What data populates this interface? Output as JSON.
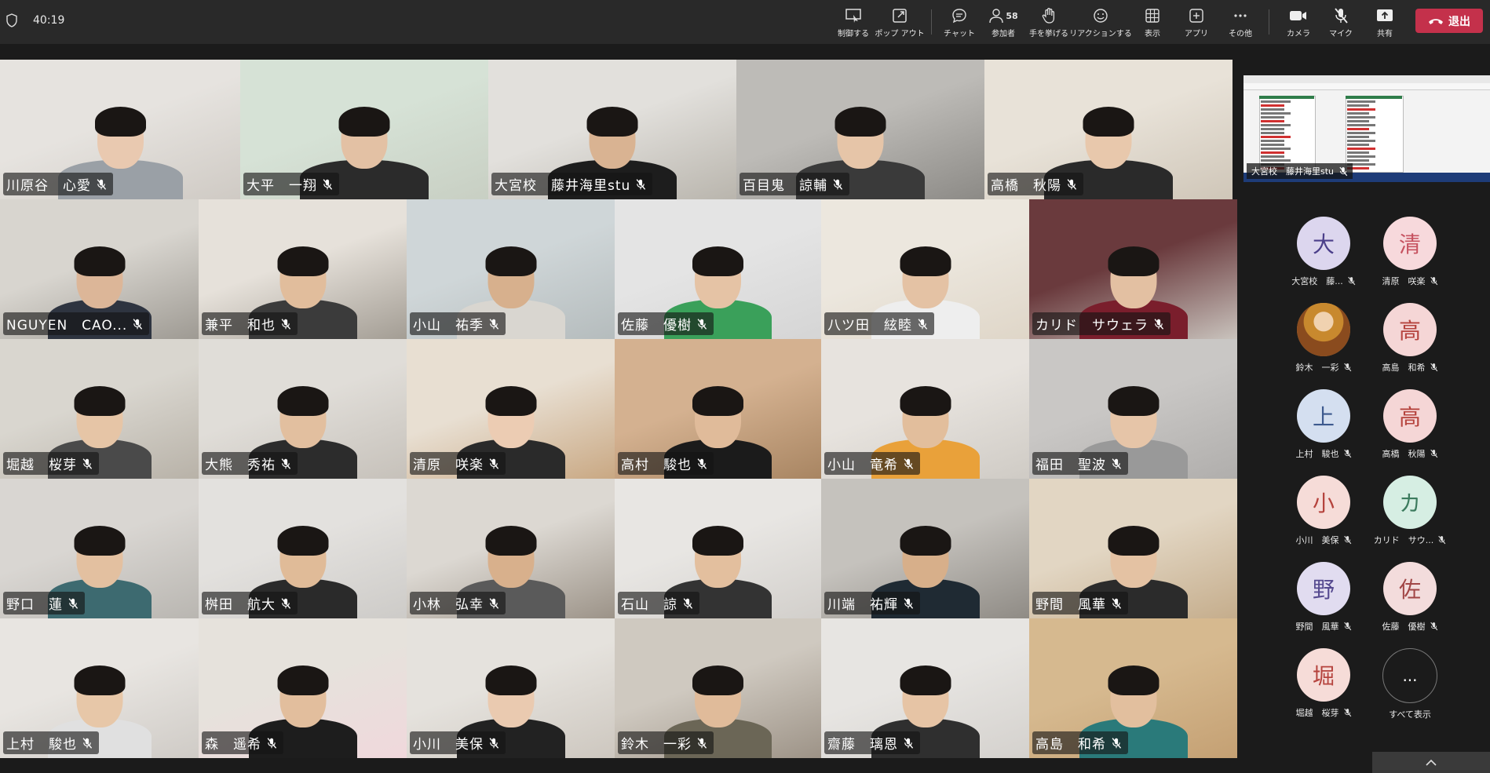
{
  "timer": "40:19",
  "toolbar": [
    {
      "name": "control-button",
      "icon": "control-icon",
      "label": "制御する"
    },
    {
      "name": "popout-button",
      "icon": "popout-icon",
      "label": "ポップ アウト"
    },
    {
      "name": "chat-button",
      "icon": "chat-icon",
      "label": "チャット"
    },
    {
      "name": "participants-button",
      "icon": "people-icon",
      "label": "参加者",
      "count": "58"
    },
    {
      "name": "raise-hand-button",
      "icon": "hand-icon",
      "label": "手を挙げる"
    },
    {
      "name": "reaction-button",
      "icon": "smile-icon",
      "label": "リアクションする"
    },
    {
      "name": "view-button",
      "icon": "grid-icon",
      "label": "表示"
    },
    {
      "name": "apps-button",
      "icon": "plus-box-icon",
      "label": "アプリ"
    },
    {
      "name": "more-button",
      "icon": "ellipsis-icon",
      "label": "その他"
    },
    {
      "name": "camera-button",
      "icon": "camera-icon",
      "label": "カメラ"
    },
    {
      "name": "mic-button",
      "icon": "mic-off-icon",
      "label": "マイク"
    },
    {
      "name": "share-button",
      "icon": "share-icon",
      "label": "共有"
    }
  ],
  "leave_label": "退出",
  "video_tiles": [
    {
      "name": "川原谷　心愛"
    },
    {
      "name": "大平　一翔"
    },
    {
      "name": "大宮校　藤井海里stu"
    },
    {
      "name": "百目鬼　諒輔"
    },
    {
      "name": "高橋　秋陽"
    },
    {
      "name": "NGUYEN　CAO..."
    },
    {
      "name": "兼平　和也"
    },
    {
      "name": "小山　祐季"
    },
    {
      "name": "佐藤　優樹"
    },
    {
      "name": "八ツ田　絃睦"
    },
    {
      "name": "カリド　サウェラ"
    },
    {
      "name": "堀越　桜芽"
    },
    {
      "name": "大熊　秀祐"
    },
    {
      "name": "清原　咲楽"
    },
    {
      "name": "高村　駿也"
    },
    {
      "name": "小山　竜希"
    },
    {
      "name": "福田　聖波"
    },
    {
      "name": "野口　蓮"
    },
    {
      "name": "桝田　航大"
    },
    {
      "name": "小林　弘幸"
    },
    {
      "name": "石山　諒"
    },
    {
      "name": "川端　祐輝"
    },
    {
      "name": "野間　風華"
    },
    {
      "name": "上村　駿也"
    },
    {
      "name": "森　遥希"
    },
    {
      "name": "小川　美保"
    },
    {
      "name": "鈴木　一彩"
    },
    {
      "name": "齋藤　璃恩"
    },
    {
      "name": "高島　和希"
    }
  ],
  "share_tile_name": "大宮校　藤井海里stu",
  "attendees": [
    {
      "initial": "大",
      "label": "大宮校　藤...",
      "bg": "#dcd6ee",
      "fg": "#4b3f8a"
    },
    {
      "initial": "清",
      "label": "清原　咲楽",
      "bg": "#f7d9dc",
      "fg": "#c65260"
    },
    {
      "initial": "",
      "label": "鈴木　一彩",
      "bg": "#b7884a",
      "fg": "#fff"
    },
    {
      "initial": "高",
      "label": "高島　和希",
      "bg": "#f5d6d6",
      "fg": "#b5433d"
    },
    {
      "initial": "上",
      "label": "上村　駿也",
      "bg": "#d4dff0",
      "fg": "#3d5a8e"
    },
    {
      "initial": "高",
      "label": "高橋　秋陽",
      "bg": "#f5d6d6",
      "fg": "#b5433d"
    },
    {
      "initial": "小",
      "label": "小川　美保",
      "bg": "#f6dcd8",
      "fg": "#b5433d"
    },
    {
      "initial": "カ",
      "label": "カリド　サウ...",
      "bg": "#d6eee3",
      "fg": "#3c7b5e"
    },
    {
      "initial": "野",
      "label": "野間　風華",
      "bg": "#e1dcf0",
      "fg": "#55498f"
    },
    {
      "initial": "佐",
      "label": "佐藤　優樹",
      "bg": "#f3dcdc",
      "fg": "#a14646"
    },
    {
      "initial": "堀",
      "label": "堀越　桜芽",
      "bg": "#f6dcd8",
      "fg": "#b5433d"
    },
    {
      "initial": "...",
      "label": "すべて表示",
      "bg": "#1b1b1b",
      "fg": "#fff"
    }
  ]
}
